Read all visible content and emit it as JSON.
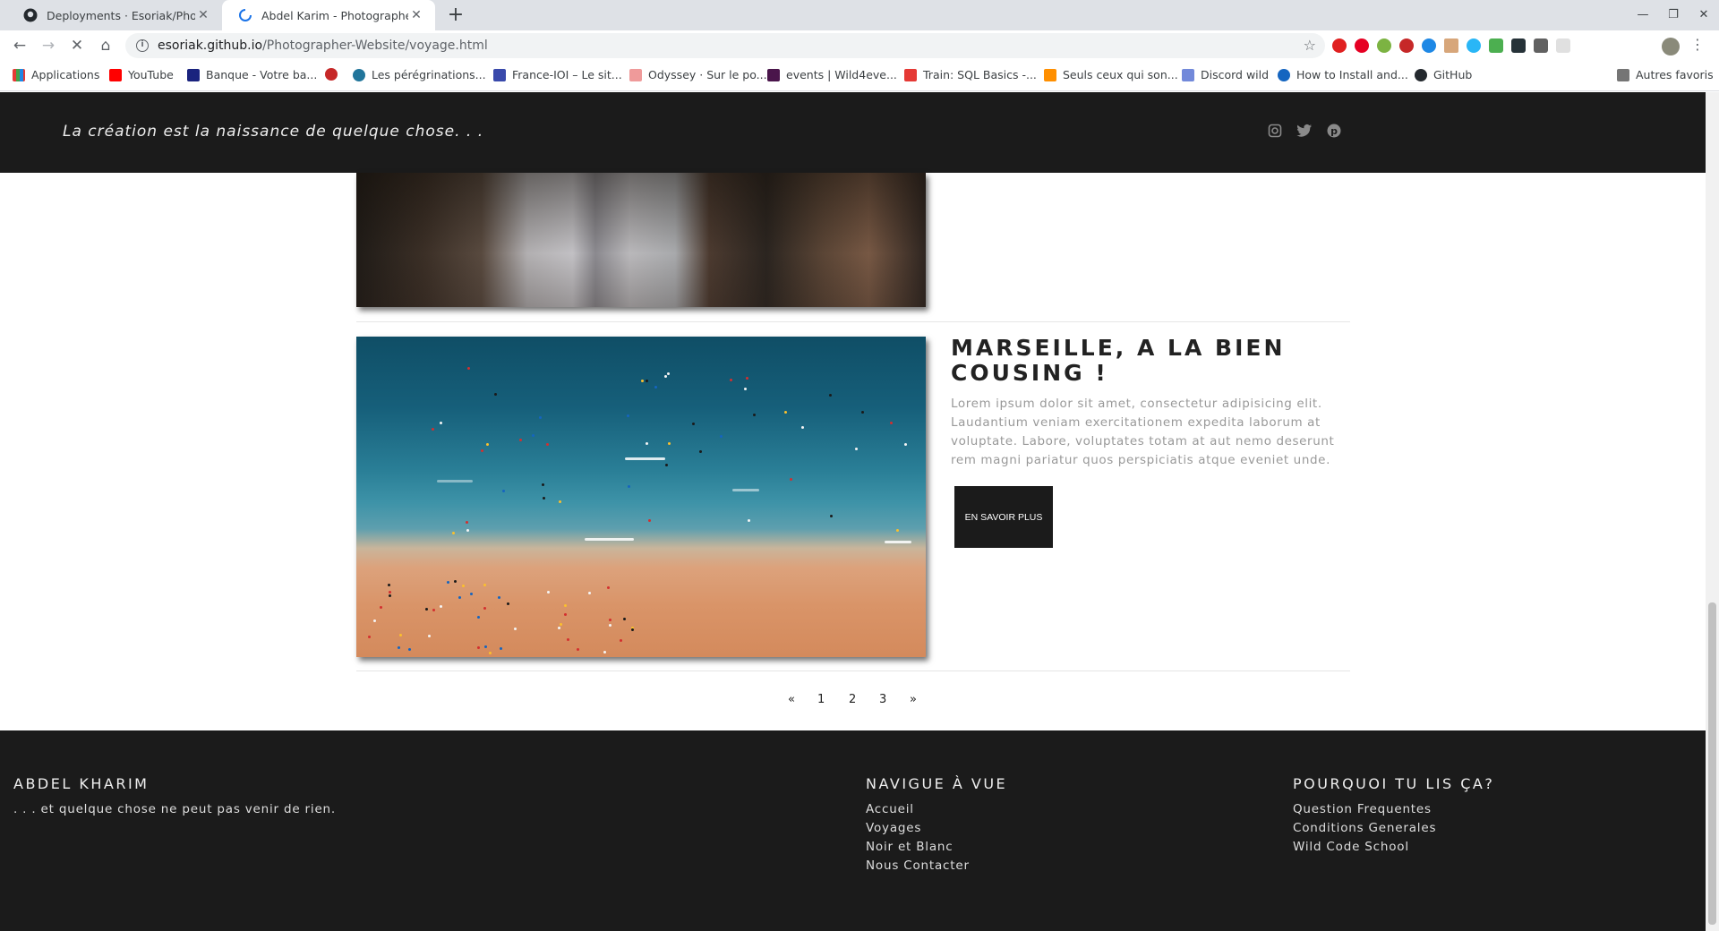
{
  "browser": {
    "tabs": [
      {
        "title": "Deployments · Esoriak/Photogr",
        "active": false
      },
      {
        "title": "Abdel Karim - Photographe",
        "active": true
      }
    ],
    "url_host": "esoriak.github.io",
    "url_path": "/Photographer-Website/voyage.html",
    "bookmarks": [
      "Applications",
      "YouTube",
      "Banque - Votre ba...",
      "",
      "Les pérégrinations...",
      "France-IOI – Le sit...",
      "Odyssey · Sur le po...",
      "events | Wild4eve...",
      "Train: SQL Basics -...",
      "Seuls ceux qui son...",
      "Discord wild",
      "How to Install and...",
      "GitHub"
    ],
    "other_bookmarks": "Autres favoris"
  },
  "header": {
    "tagline": "La création est la naissance de quelque chose. . ."
  },
  "article": {
    "title": "MARSEILLE, A LA BIEN COUSING !",
    "text": "Lorem ipsum dolor sit amet, consectetur adipisicing elit. Laudantium veniam exercitationem expedita laborum at voluptate. Labore, voluptates totam at aut nemo deserunt rem magni pariatur quos perspiciatis atque eveniet unde.",
    "button": "EN SAVOIR PLUS"
  },
  "pagination": {
    "prev": "«",
    "pages": [
      "1",
      "2",
      "3"
    ],
    "next": "»"
  },
  "footer": {
    "col1": {
      "title": "ABDEL KHARIM",
      "text": ". . . et quelque chose ne peut pas venir de rien."
    },
    "col2": {
      "title": "NAVIGUE À VUE",
      "links": [
        "Accueil",
        "Voyages",
        "Noir et Blanc",
        "Nous Contacter"
      ]
    },
    "col3": {
      "title": "POURQUOI TU LIS ÇA?",
      "links": [
        "Question Frequentes",
        "Conditions Generales",
        "Wild Code School"
      ]
    }
  },
  "colors": {
    "header_bg": "#1b1b1b",
    "footer_bg": "#1b1b1b",
    "button_bg": "#1b1b1b"
  },
  "icons": [
    "github-icon",
    "loading-icon",
    "instagram-icon",
    "twitter-icon",
    "pinterest-icon"
  ]
}
